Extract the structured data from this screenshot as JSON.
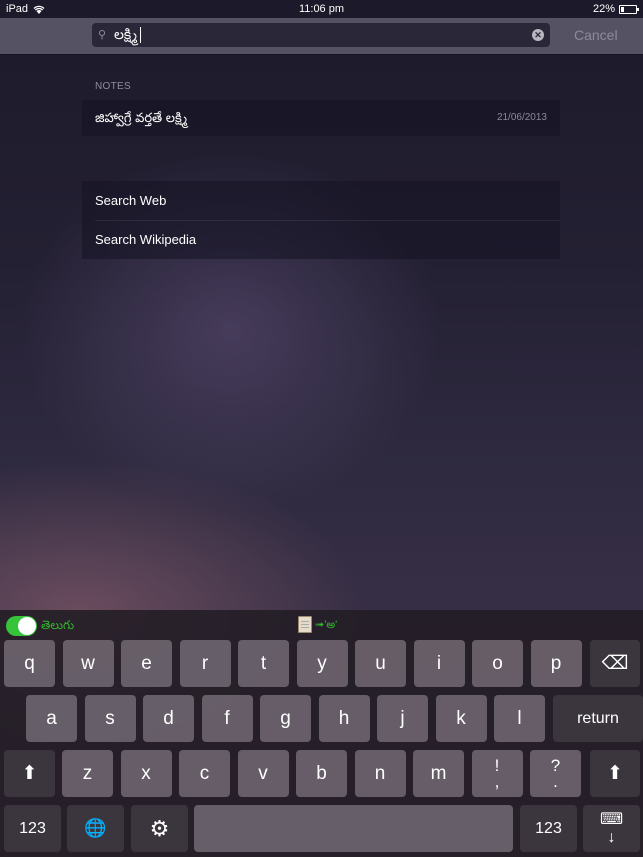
{
  "status": {
    "device": "iPad",
    "time": "11:06 pm",
    "battery_percent_label": "22%",
    "battery_level": 0.22
  },
  "search": {
    "icon": "search-icon",
    "value": "లక్ష్మి",
    "clear_icon": "clear-icon",
    "cancel_label": "Cancel"
  },
  "results": {
    "notes_header": "NOTES",
    "notes": [
      {
        "title": "జిహ్వాగ్రే వర్తతే లక్ష్మి",
        "date": "21/06/2013"
      }
    ],
    "actions": [
      {
        "label": "Search Web"
      },
      {
        "label": "Search Wikipedia"
      }
    ]
  },
  "keyboard": {
    "toggle_on": true,
    "language_label": "తెలుగు",
    "clipboard_hint": "➟'అ'",
    "row1": [
      "q",
      "w",
      "e",
      "r",
      "t",
      "y",
      "u",
      "i",
      "o",
      "p"
    ],
    "row2": [
      "a",
      "s",
      "d",
      "f",
      "g",
      "h",
      "j",
      "k",
      "l"
    ],
    "row3": [
      "z",
      "x",
      "c",
      "v",
      "b",
      "n",
      "m"
    ],
    "punct1": {
      "top": "!",
      "bottom": ","
    },
    "punct2": {
      "top": "?",
      "bottom": "."
    },
    "return_label": "return",
    "numbers_label": "123",
    "shift_icon": "⬆",
    "delete_icon": "⌫",
    "globe_icon": "🌐",
    "settings_icon": "⚙",
    "dismiss_icon": "⌨"
  }
}
